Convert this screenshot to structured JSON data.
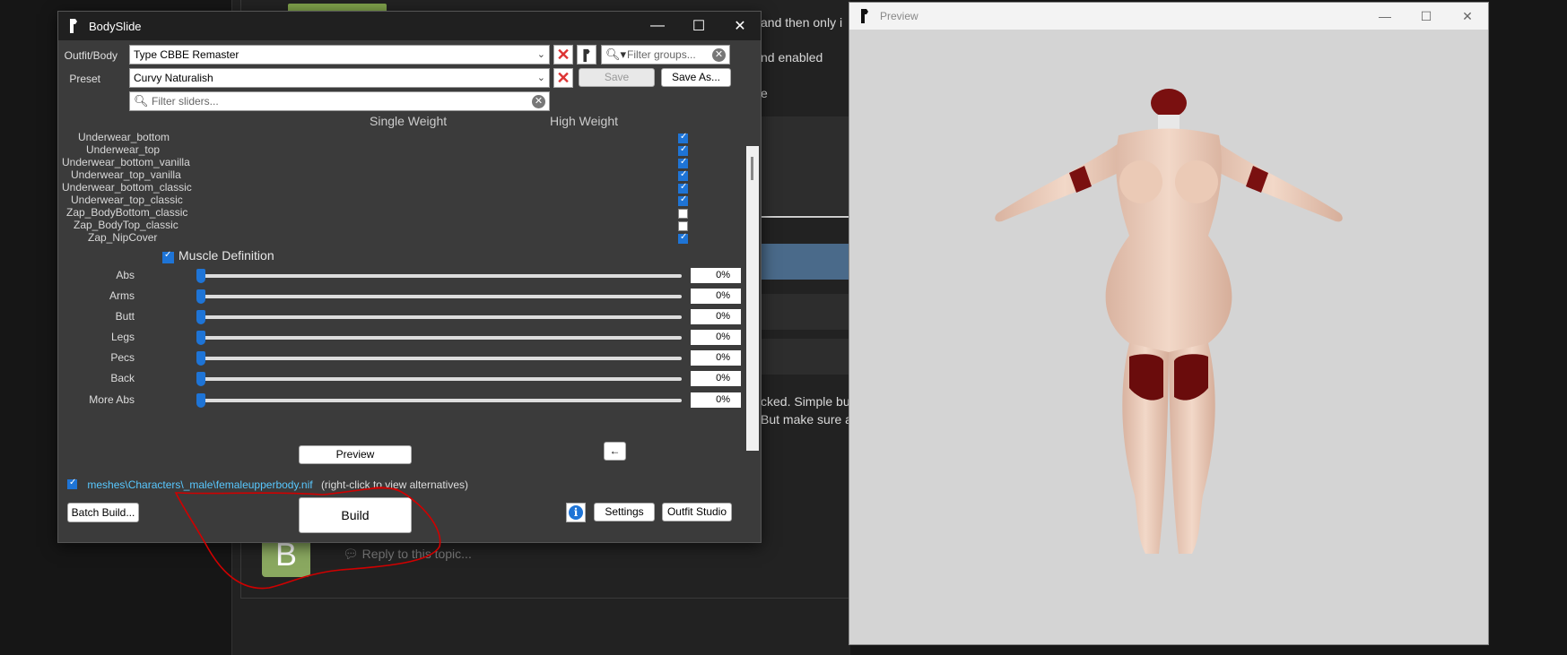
{
  "background": {
    "text_lines": [
      "and then only i",
      "nd enabled",
      "e",
      "cked. Simple bu",
      "But make sure as"
    ],
    "avatar_letter": "B",
    "reply_placeholder": "Reply to this topic..."
  },
  "bodyslide": {
    "title": "BodySlide",
    "controls": {
      "minimize": "—",
      "maximize": "☐",
      "close": "✕"
    },
    "outfit_label": "Outfit/Body",
    "outfit_value": "Type CBBE Remaster",
    "filter_groups_placeholder": "Filter groups...",
    "preset_label": "Preset",
    "preset_value": "Curvy Naturalish",
    "save_label": "Save",
    "save_as_label": "Save As...",
    "filter_sliders_placeholder": "Filter sliders...",
    "col_single": "Single Weight",
    "col_high": "High Weight",
    "groups": [
      {
        "name": "Underwear_bottom",
        "checked": true
      },
      {
        "name": "Underwear_top",
        "checked": true
      },
      {
        "name": "Underwear_bottom_vanilla",
        "checked": true
      },
      {
        "name": "Underwear_top_vanilla",
        "checked": true
      },
      {
        "name": "Underwear_bottom_classic",
        "checked": true
      },
      {
        "name": "Underwear_top_classic",
        "checked": true
      },
      {
        "name": "Zap_BodyBottom_classic",
        "checked": false
      },
      {
        "name": "Zap_BodyTop_classic",
        "checked": false
      },
      {
        "name": "Zap_NipCover",
        "checked": true
      }
    ],
    "category": "Muscle Definition",
    "sliders": [
      {
        "name": "Abs",
        "value": "0%"
      },
      {
        "name": "Arms",
        "value": "0%"
      },
      {
        "name": "Butt",
        "value": "0%"
      },
      {
        "name": "Legs",
        "value": "0%"
      },
      {
        "name": "Pecs",
        "value": "0%"
      },
      {
        "name": "Back",
        "value": "0%"
      },
      {
        "name": "More Abs",
        "value": "0%"
      }
    ],
    "preview_label": "Preview",
    "arrow_label": "←",
    "nif_path": "meshes\\Characters\\_male\\femaleupperbody.nif",
    "nif_hint": "(right-click to view alternatives)",
    "batch_build_label": "Batch Build...",
    "build_label": "Build",
    "settings_label": "Settings",
    "outfit_studio_label": "Outfit Studio",
    "info_icon_label": "i"
  },
  "preview": {
    "title": "Preview",
    "controls": {
      "minimize": "—",
      "maximize": "☐",
      "close": "✕"
    }
  },
  "colors": {
    "accent": "#1e74d6",
    "window_bg": "#3b3b3b",
    "titlebar_bg": "#202020",
    "preview_bg": "#d4d4d4",
    "annotation": "#d00000",
    "nif_link": "#58c8ff"
  }
}
